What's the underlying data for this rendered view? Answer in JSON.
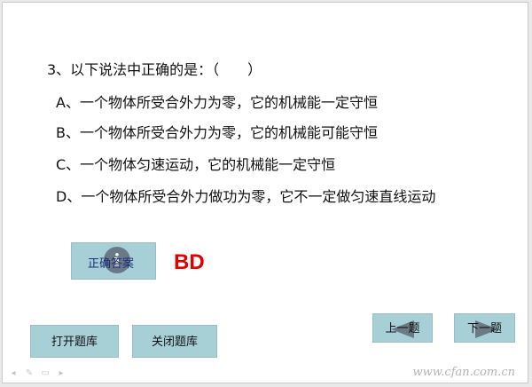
{
  "question": {
    "text": "3、以下说法中正确的是：（　　）",
    "options": [
      "A、一个物体所受合外力为零，它的机械能一定守恒",
      "B、一个物体所受合外力为零，它的机械能可能守恒",
      "C、一个物体匀速运动，它的机械能一定守恒",
      "D、一个物体所受合外力做功为零，它不一定做匀速直线运动"
    ]
  },
  "answer_button": {
    "label": "正确答案",
    "icon": "info-icon"
  },
  "answer": {
    "value": "BD",
    "color": "#e00000"
  },
  "buttons": {
    "open": "打开题库",
    "close": "关闭题库",
    "prev": "上一题",
    "next": "下一题"
  },
  "watermark": "www.cfan.com.cn",
  "colors": {
    "button_bg": "#a6cfd6"
  }
}
